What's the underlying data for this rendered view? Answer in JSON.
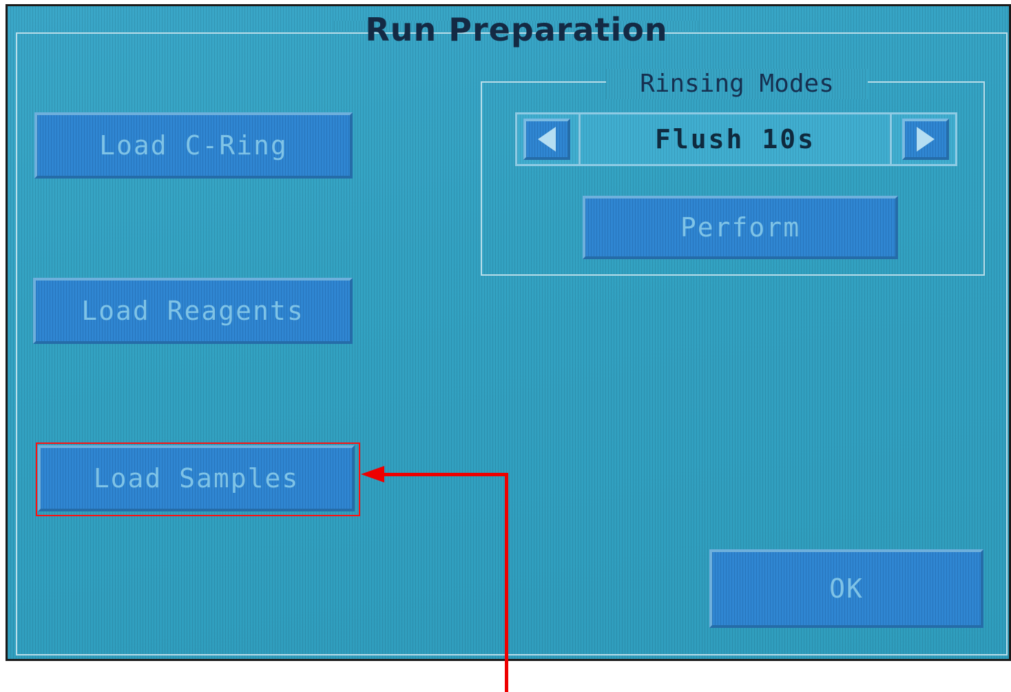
{
  "window": {
    "title": "Run Preparation"
  },
  "buttons": {
    "load_c_ring": "Load C-Ring",
    "load_reagents": "Load Reagents",
    "load_samples": "Load Samples",
    "ok": "OK"
  },
  "rinsing": {
    "label": "Rinsing Modes",
    "mode_value": "Flush 10s",
    "perform": "Perform",
    "prev_icon": "triangle-left-icon",
    "next_icon": "triangle-right-icon"
  },
  "annotation": {
    "highlight_color": "#ff1010",
    "arrow_color": "#ee0000"
  },
  "colors": {
    "screen_bg": "#33a2c2",
    "button_bg": "#2f86d2",
    "button_text": "#7fc3e6",
    "title_text": "#142a44"
  }
}
